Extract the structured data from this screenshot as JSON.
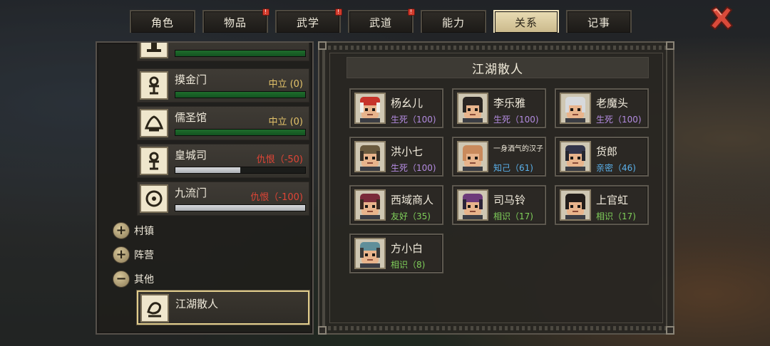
{
  "tabs": [
    {
      "label": "角色",
      "badge": false
    },
    {
      "label": "物品",
      "badge": true
    },
    {
      "label": "武学",
      "badge": true
    },
    {
      "label": "武道",
      "badge": true
    },
    {
      "label": "能力",
      "badge": false
    },
    {
      "label": "关系",
      "badge": false,
      "active": true
    },
    {
      "label": "记事",
      "badge": false
    }
  ],
  "badge_glyph": "!",
  "close_icon": "close-x-icon",
  "factions": [
    {
      "name": "",
      "status": "",
      "bar": "green",
      "fill": 1.0,
      "icon": "emblem-icon"
    },
    {
      "name": "摸金门",
      "status": "中立 (0)",
      "tone": "neutral",
      "bar": "green",
      "fill": 1.0,
      "icon": "emblem-icon"
    },
    {
      "name": "儒圣馆",
      "status": "中立 (0)",
      "tone": "neutral",
      "bar": "green",
      "fill": 1.0,
      "icon": "scroll-emblem-icon"
    },
    {
      "name": "皇城司",
      "status": "仇恨（-50)",
      "tone": "hate",
      "bar": "white",
      "fill": 0.5,
      "icon": "emblem-icon"
    },
    {
      "name": "九流门",
      "status": "仇恨（-100)",
      "tone": "hate",
      "bar": "white",
      "fill": 1.0,
      "icon": "circle-emblem-icon"
    }
  ],
  "categories": [
    {
      "label": "村镇",
      "toggle": "+"
    },
    {
      "label": "阵营",
      "toggle": "+"
    },
    {
      "label": "其他",
      "toggle": "−"
    }
  ],
  "selected_faction": {
    "name": "江湖散人",
    "icon": "wanderer-emblem-icon"
  },
  "panel_title": "江湖散人",
  "npcs": [
    {
      "name": "杨幺儿",
      "relation": "生死（100)",
      "tone": "life",
      "hair": "#f0efe9",
      "cap": "#c7342b"
    },
    {
      "name": "李乐雅",
      "relation": "生死（100)",
      "tone": "life",
      "hair": "#2a2522",
      "cap": "#2a2522"
    },
    {
      "name": "老魔头",
      "relation": "生死（100)",
      "tone": "life",
      "hair": "#d7d9dc",
      "cap": "#d7d9dc"
    },
    {
      "name": "洪小七",
      "relation": "生死（100)",
      "tone": "life",
      "hair": "#3a3228",
      "cap": "#6a5a3e"
    },
    {
      "name": "一身酒气的汉子",
      "relation": "知己（61)",
      "tone": "bond",
      "hair": "#c98a5c",
      "cap": "#c98a5c",
      "small": true
    },
    {
      "name": "货郎",
      "relation": "亲密（46)",
      "tone": "bond",
      "hair": "#25262e",
      "cap": "#33354a"
    },
    {
      "name": "西域商人",
      "relation": "友好（35)",
      "tone": "friend",
      "hair": "#3b2a22",
      "cap": "#7a2a3a"
    },
    {
      "name": "司马铃",
      "relation": "相识（17)",
      "tone": "friend",
      "hair": "#2b2438",
      "cap": "#6d3a7a"
    },
    {
      "name": "上官虹",
      "relation": "相识（17)",
      "tone": "friend",
      "hair": "#221d1a",
      "cap": "#221d1a"
    },
    {
      "name": "方小白",
      "relation": "相识（8)",
      "tone": "friend",
      "hair": "#3a3a3a",
      "cap": "#5f8f9a"
    }
  ]
}
